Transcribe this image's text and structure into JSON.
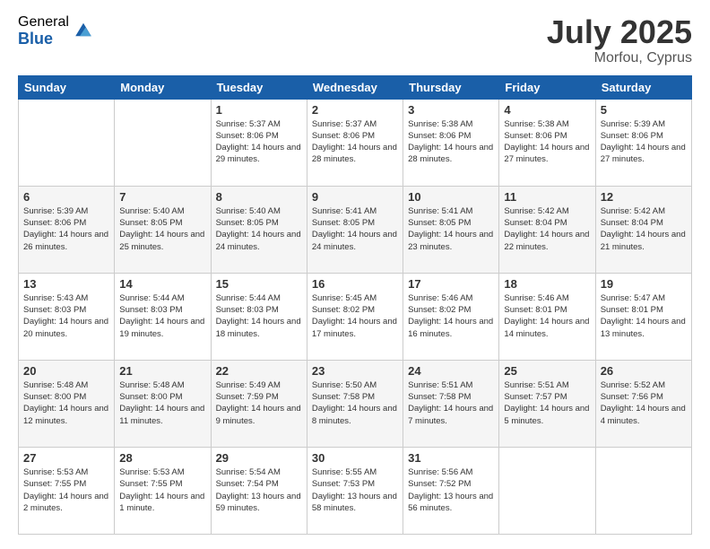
{
  "logo": {
    "general": "General",
    "blue": "Blue"
  },
  "header": {
    "month": "July 2025",
    "location": "Morfou, Cyprus"
  },
  "weekdays": [
    "Sunday",
    "Monday",
    "Tuesday",
    "Wednesday",
    "Thursday",
    "Friday",
    "Saturday"
  ],
  "weeks": [
    [
      {
        "day": "",
        "info": ""
      },
      {
        "day": "",
        "info": ""
      },
      {
        "day": "1",
        "sunrise": "Sunrise: 5:37 AM",
        "sunset": "Sunset: 8:06 PM",
        "daylight": "Daylight: 14 hours and 29 minutes."
      },
      {
        "day": "2",
        "sunrise": "Sunrise: 5:37 AM",
        "sunset": "Sunset: 8:06 PM",
        "daylight": "Daylight: 14 hours and 28 minutes."
      },
      {
        "day": "3",
        "sunrise": "Sunrise: 5:38 AM",
        "sunset": "Sunset: 8:06 PM",
        "daylight": "Daylight: 14 hours and 28 minutes."
      },
      {
        "day": "4",
        "sunrise": "Sunrise: 5:38 AM",
        "sunset": "Sunset: 8:06 PM",
        "daylight": "Daylight: 14 hours and 27 minutes."
      },
      {
        "day": "5",
        "sunrise": "Sunrise: 5:39 AM",
        "sunset": "Sunset: 8:06 PM",
        "daylight": "Daylight: 14 hours and 27 minutes."
      }
    ],
    [
      {
        "day": "6",
        "sunrise": "Sunrise: 5:39 AM",
        "sunset": "Sunset: 8:06 PM",
        "daylight": "Daylight: 14 hours and 26 minutes."
      },
      {
        "day": "7",
        "sunrise": "Sunrise: 5:40 AM",
        "sunset": "Sunset: 8:05 PM",
        "daylight": "Daylight: 14 hours and 25 minutes."
      },
      {
        "day": "8",
        "sunrise": "Sunrise: 5:40 AM",
        "sunset": "Sunset: 8:05 PM",
        "daylight": "Daylight: 14 hours and 24 minutes."
      },
      {
        "day": "9",
        "sunrise": "Sunrise: 5:41 AM",
        "sunset": "Sunset: 8:05 PM",
        "daylight": "Daylight: 14 hours and 24 minutes."
      },
      {
        "day": "10",
        "sunrise": "Sunrise: 5:41 AM",
        "sunset": "Sunset: 8:05 PM",
        "daylight": "Daylight: 14 hours and 23 minutes."
      },
      {
        "day": "11",
        "sunrise": "Sunrise: 5:42 AM",
        "sunset": "Sunset: 8:04 PM",
        "daylight": "Daylight: 14 hours and 22 minutes."
      },
      {
        "day": "12",
        "sunrise": "Sunrise: 5:42 AM",
        "sunset": "Sunset: 8:04 PM",
        "daylight": "Daylight: 14 hours and 21 minutes."
      }
    ],
    [
      {
        "day": "13",
        "sunrise": "Sunrise: 5:43 AM",
        "sunset": "Sunset: 8:03 PM",
        "daylight": "Daylight: 14 hours and 20 minutes."
      },
      {
        "day": "14",
        "sunrise": "Sunrise: 5:44 AM",
        "sunset": "Sunset: 8:03 PM",
        "daylight": "Daylight: 14 hours and 19 minutes."
      },
      {
        "day": "15",
        "sunrise": "Sunrise: 5:44 AM",
        "sunset": "Sunset: 8:03 PM",
        "daylight": "Daylight: 14 hours and 18 minutes."
      },
      {
        "day": "16",
        "sunrise": "Sunrise: 5:45 AM",
        "sunset": "Sunset: 8:02 PM",
        "daylight": "Daylight: 14 hours and 17 minutes."
      },
      {
        "day": "17",
        "sunrise": "Sunrise: 5:46 AM",
        "sunset": "Sunset: 8:02 PM",
        "daylight": "Daylight: 14 hours and 16 minutes."
      },
      {
        "day": "18",
        "sunrise": "Sunrise: 5:46 AM",
        "sunset": "Sunset: 8:01 PM",
        "daylight": "Daylight: 14 hours and 14 minutes."
      },
      {
        "day": "19",
        "sunrise": "Sunrise: 5:47 AM",
        "sunset": "Sunset: 8:01 PM",
        "daylight": "Daylight: 14 hours and 13 minutes."
      }
    ],
    [
      {
        "day": "20",
        "sunrise": "Sunrise: 5:48 AM",
        "sunset": "Sunset: 8:00 PM",
        "daylight": "Daylight: 14 hours and 12 minutes."
      },
      {
        "day": "21",
        "sunrise": "Sunrise: 5:48 AM",
        "sunset": "Sunset: 8:00 PM",
        "daylight": "Daylight: 14 hours and 11 minutes."
      },
      {
        "day": "22",
        "sunrise": "Sunrise: 5:49 AM",
        "sunset": "Sunset: 7:59 PM",
        "daylight": "Daylight: 14 hours and 9 minutes."
      },
      {
        "day": "23",
        "sunrise": "Sunrise: 5:50 AM",
        "sunset": "Sunset: 7:58 PM",
        "daylight": "Daylight: 14 hours and 8 minutes."
      },
      {
        "day": "24",
        "sunrise": "Sunrise: 5:51 AM",
        "sunset": "Sunset: 7:58 PM",
        "daylight": "Daylight: 14 hours and 7 minutes."
      },
      {
        "day": "25",
        "sunrise": "Sunrise: 5:51 AM",
        "sunset": "Sunset: 7:57 PM",
        "daylight": "Daylight: 14 hours and 5 minutes."
      },
      {
        "day": "26",
        "sunrise": "Sunrise: 5:52 AM",
        "sunset": "Sunset: 7:56 PM",
        "daylight": "Daylight: 14 hours and 4 minutes."
      }
    ],
    [
      {
        "day": "27",
        "sunrise": "Sunrise: 5:53 AM",
        "sunset": "Sunset: 7:55 PM",
        "daylight": "Daylight: 14 hours and 2 minutes."
      },
      {
        "day": "28",
        "sunrise": "Sunrise: 5:53 AM",
        "sunset": "Sunset: 7:55 PM",
        "daylight": "Daylight: 14 hours and 1 minute."
      },
      {
        "day": "29",
        "sunrise": "Sunrise: 5:54 AM",
        "sunset": "Sunset: 7:54 PM",
        "daylight": "Daylight: 13 hours and 59 minutes."
      },
      {
        "day": "30",
        "sunrise": "Sunrise: 5:55 AM",
        "sunset": "Sunset: 7:53 PM",
        "daylight": "Daylight: 13 hours and 58 minutes."
      },
      {
        "day": "31",
        "sunrise": "Sunrise: 5:56 AM",
        "sunset": "Sunset: 7:52 PM",
        "daylight": "Daylight: 13 hours and 56 minutes."
      },
      {
        "day": "",
        "info": ""
      },
      {
        "day": "",
        "info": ""
      }
    ]
  ]
}
